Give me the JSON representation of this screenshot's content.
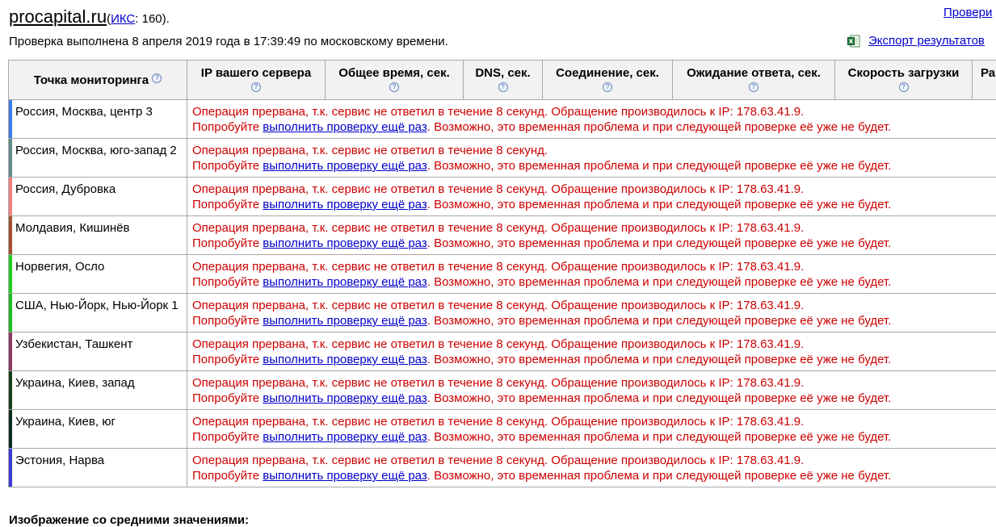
{
  "header": {
    "site": "procapital.ru",
    "iks_open": "(",
    "iks_label": "ИКС",
    "iks_value": ": 160).",
    "top_right_link": "Провери",
    "checked_text": "Проверка выполнена 8 апреля 2019 года в 17:39:49 по московскому времени.",
    "export_label": "Экспорт результатов"
  },
  "table": {
    "columns": [
      "Точка мониторинга",
      "IP вашего сервера",
      "Общее время, сек.",
      "DNS, сек.",
      "Соединение, сек.",
      "Ожидание ответа, сек.",
      "Скорость загрузки",
      "Ра"
    ],
    "help_glyph": "?",
    "message_part1_full": "Операция прервана, т.к. сервис не ответил в течение 8 секунд. Обращение производилось к IP: 178.63.41.9.",
    "message_part1_short": "Операция прервана, т.к. сервис не ответил в течение 8 секунд.",
    "retry_prefix": "Попробуйте ",
    "retry_link": "выполнить проверку ещё раз",
    "retry_suffix": ". Возможно, это временная проблема и при следующей проверке её уже не будет.",
    "rows": [
      {
        "location": "Россия, Москва, центр 3",
        "color": "#3d7be6",
        "short": false
      },
      {
        "location": "Россия, Москва, юго-запад 2",
        "color": "#5f8a8b",
        "short": true
      },
      {
        "location": "Россия, Дубровка",
        "color": "#f08080",
        "short": false
      },
      {
        "location": "Молдавия, Кишинёв",
        "color": "#a0522d",
        "short": false
      },
      {
        "location": "Норвегия, Осло",
        "color": "#22cc22",
        "short": false
      },
      {
        "location": "США, Нью-Йорк, Нью-Йорк 1",
        "color": "#22bb22",
        "short": false
      },
      {
        "location": "Узбекистан, Ташкент",
        "color": "#8b3a62",
        "short": false
      },
      {
        "location": "Украина, Киев, запад",
        "color": "#1a3d1a",
        "short": false
      },
      {
        "location": "Украина, Киев, юг",
        "color": "#0b2b1b",
        "short": false
      },
      {
        "location": "Эстония, Нарва",
        "color": "#3a3ad4",
        "short": false
      }
    ]
  },
  "footer": {
    "title": "Изображение со средними значениями:"
  }
}
